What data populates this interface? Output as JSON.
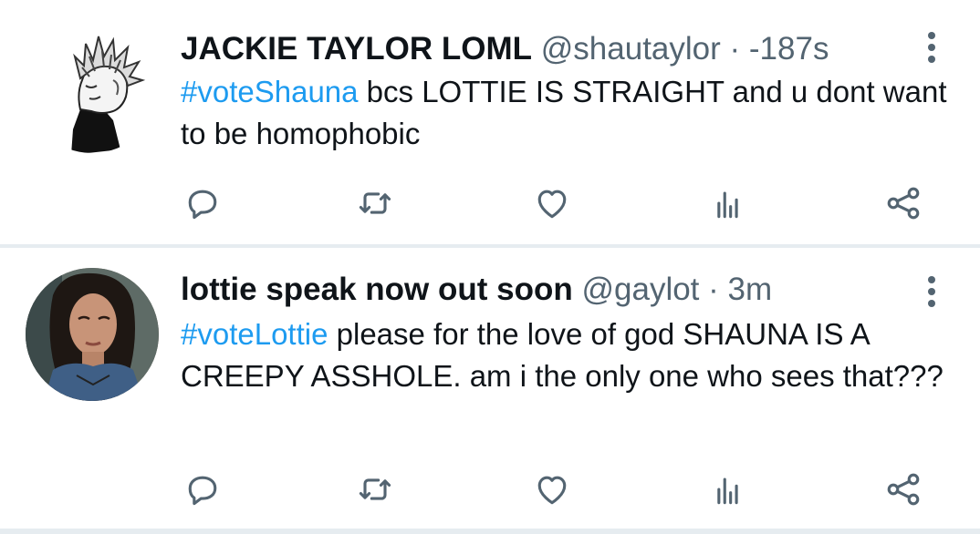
{
  "tweets": [
    {
      "display_name": "JACKIE TAYLOR LOML",
      "handle": "@shautaylor",
      "separator": "·",
      "time": "-187s",
      "hashtag": "#voteShauna",
      "text": " bcs LOTTIE IS STRAIGHT and u dont want to be homophobic"
    },
    {
      "display_name": "lottie speak now out soon",
      "handle": "@gaylot",
      "separator": "·",
      "time": "3m",
      "hashtag": "#voteLottie",
      "text": " please for the love of god  SHAUNA IS A CREEPY ASSHOLE. am i the only one who sees that???"
    }
  ],
  "icons": [
    "reply-icon",
    "retweet-icon",
    "like-icon",
    "views-icon",
    "share-icon",
    "more-options-icon"
  ],
  "colors": {
    "hashtag": "#1d9bf0",
    "icon": "#536471",
    "separator": "#e6ecf0"
  }
}
